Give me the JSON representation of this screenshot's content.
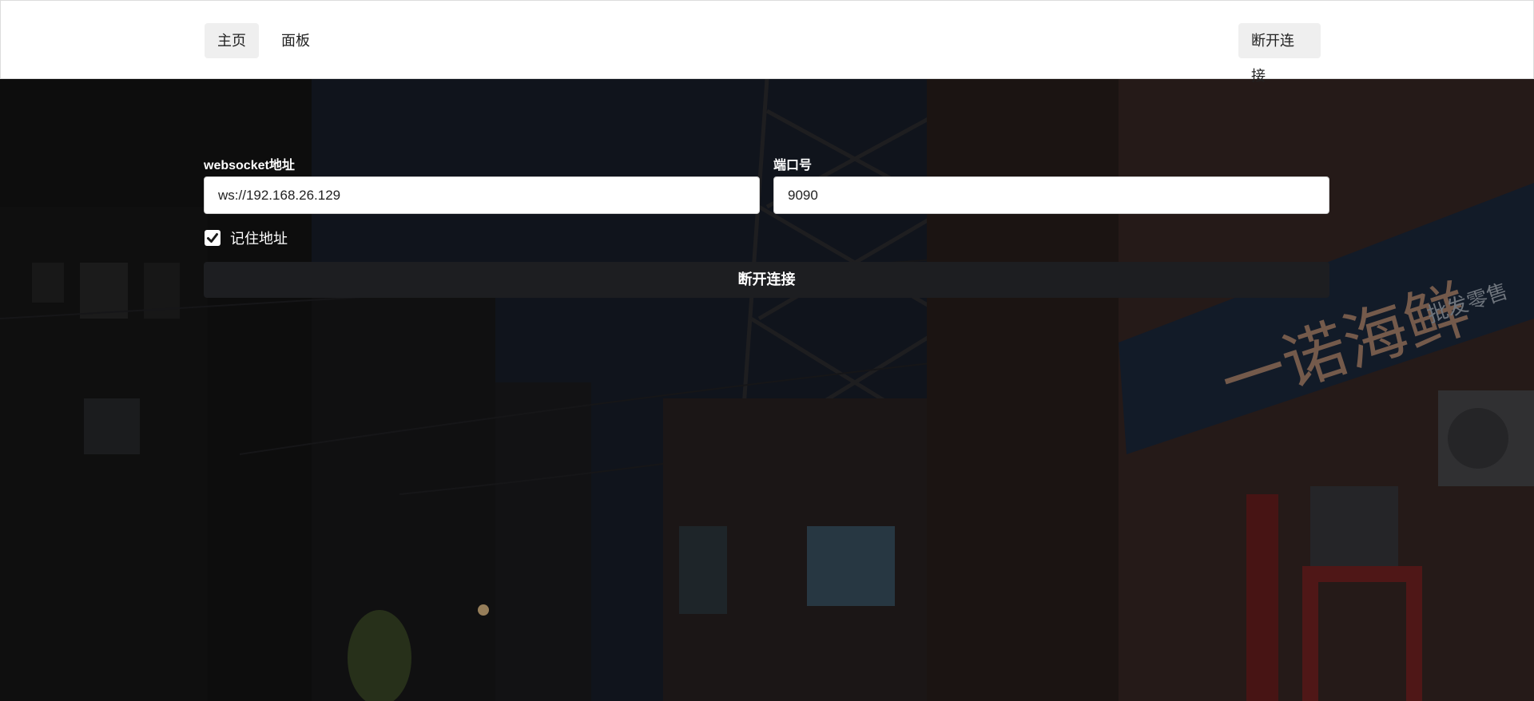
{
  "nav": {
    "home_label": "主页",
    "panel_label": "面板",
    "disconnect_label": "断开连接"
  },
  "form": {
    "ws_label": "websocket地址",
    "ws_value": "ws://192.168.26.129",
    "port_label": "端口号",
    "port_value": "9090",
    "remember_label": "记住地址",
    "remember_checked": true,
    "submit_label": "断开连接"
  },
  "background": {
    "sign_text": "一诺海鲜",
    "sign_subtext": "批发零售",
    "accent_color": "#8a2a2a"
  }
}
